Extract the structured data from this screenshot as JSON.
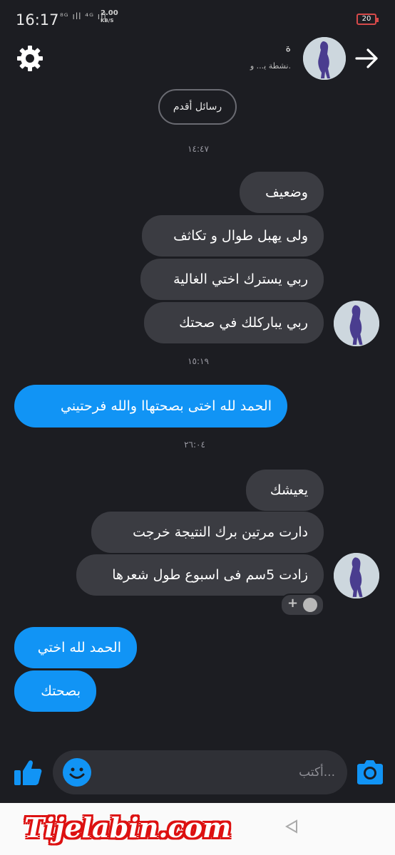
{
  "status_bar": {
    "time": "16:17",
    "indicators": "⁸ᴳ ıll ⁴ᴳ ıll",
    "speed_value": "2.00",
    "speed_unit": "KB/S",
    "battery": "20"
  },
  "header": {
    "contact_name": "ﺓ",
    "contact_status": "ﻧﺸﻄﺔ ﻳ... ﻭ.",
    "settings_icon": "gear-icon",
    "back_icon": "arrow-right-icon"
  },
  "older_messages_button": "رسائل أقدم",
  "timestamps": [
    "١٤:٤٧",
    "١٥:١٩",
    "٢٦:٠٤"
  ],
  "messages": [
    {
      "text": "وضعيف",
      "direction": "in"
    },
    {
      "text": "ولى يهبل طوال و تكاثف",
      "direction": "in"
    },
    {
      "text": "ربي يسترك اختي الغالية",
      "direction": "in"
    },
    {
      "text": "ربي يباركلك في صحتك",
      "direction": "in"
    },
    {
      "text": "الحمد لله اختى بصحتهاا والله فرحتيني",
      "direction": "out"
    },
    {
      "text": "يعيشك",
      "direction": "in"
    },
    {
      "text": "دارت مرتين برك النتيجة خرجت",
      "direction": "in"
    },
    {
      "text": "زادت 5سم فى اسبوع طول شعرها",
      "direction": "in"
    },
    {
      "text": "الحمد لله اختي",
      "direction": "out"
    },
    {
      "text": "بصحتك",
      "direction": "out"
    }
  ],
  "composer": {
    "placeholder": "...أكتب",
    "like_icon": "thumbs-up-icon",
    "emoji_icon": "smiley-icon",
    "camera_icon": "camera-icon"
  },
  "watermark": "Tijelabin.com",
  "colors": {
    "background": "#1c1d22",
    "incoming_bubble": "#3b3c42",
    "outgoing_bubble": "#1194f5",
    "accent": "#1194f5"
  }
}
